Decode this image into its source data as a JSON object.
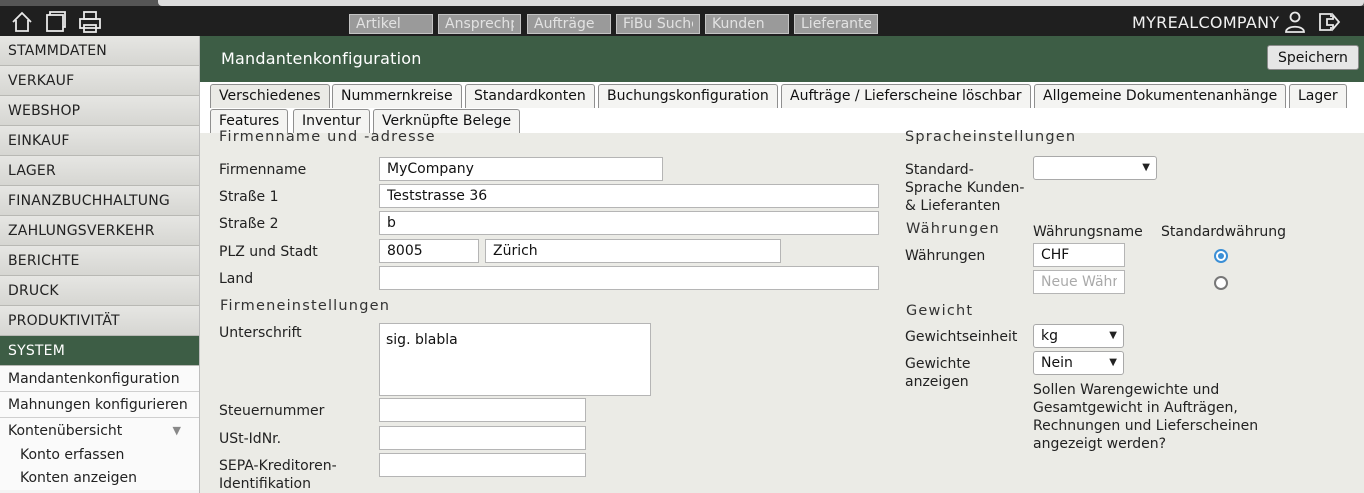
{
  "topbar": {
    "searches": [
      {
        "placeholder": "Artikel"
      },
      {
        "placeholder": "Ansprechpe"
      },
      {
        "placeholder": "Aufträge"
      },
      {
        "placeholder": "FiBu Suche"
      },
      {
        "placeholder": "Kunden"
      },
      {
        "placeholder": "Lieferanten"
      }
    ],
    "company": "MYREALCOMPANY",
    "icons": [
      "home-icon",
      "window-icon",
      "printer-icon",
      "user-icon",
      "logout-icon"
    ]
  },
  "sidebar": {
    "items": [
      {
        "label": "STAMMDATEN"
      },
      {
        "label": "VERKAUF"
      },
      {
        "label": "WEBSHOP"
      },
      {
        "label": "EINKAUF"
      },
      {
        "label": "LAGER"
      },
      {
        "label": "FINANZBUCHHALTUNG"
      },
      {
        "label": "ZAHLUNGSVERKEHR"
      },
      {
        "label": "BERICHTE"
      },
      {
        "label": "DRUCK"
      },
      {
        "label": "PRODUKTIVITÄT"
      },
      {
        "label": "SYSTEM"
      }
    ],
    "subitems": [
      {
        "label": "Mandantenkonfiguration"
      },
      {
        "label": "Mahnungen konfigurieren"
      },
      {
        "label": "Kontenübersicht"
      }
    ],
    "subsubitems": [
      {
        "label": "Konto erfassen"
      },
      {
        "label": "Konten anzeigen"
      }
    ],
    "active_color": "#3d5d45"
  },
  "main": {
    "title": "Mandantenkonfiguration",
    "save_label": "Speichern",
    "tabs": [
      {
        "label": "Verschiedenes"
      },
      {
        "label": "Nummernkreise"
      },
      {
        "label": "Standardkonten"
      },
      {
        "label": "Buchungskonfiguration"
      },
      {
        "label": "Aufträge / Lieferscheine löschbar"
      },
      {
        "label": "Allgemeine Dokumentenanhänge"
      },
      {
        "label": "Lager"
      },
      {
        "label": "Features"
      },
      {
        "label": "Inventur"
      },
      {
        "label": "Verknüpfte Belege"
      }
    ]
  },
  "company_section": {
    "title": "Firmenname und -adresse",
    "name_label": "Firmenname",
    "name_value": "MyCompany",
    "street1_label": "Straße 1",
    "street1_value": "Teststrasse 36",
    "street2_label": "Straße 2",
    "street2_value": "b",
    "zip_city_label": "PLZ und Stadt",
    "zip_value": "8005",
    "city_value": "Zürich",
    "country_label": "Land",
    "country_value": ""
  },
  "settings_section": {
    "title": "Firmeneinstellungen",
    "signature_label": "Unterschrift",
    "signature_value": "sig. blabla",
    "tax_number_label": "Steuernummer",
    "tax_number_value": "",
    "vat_label": "USt-IdNr.",
    "vat_value": "",
    "sepa_label_1": "SEPA-Kreditoren-",
    "sepa_label_2": "Identifikation",
    "sepa_value": ""
  },
  "language_section": {
    "title": "Spracheinstellungen",
    "std_lang_label_1": "Standard-",
    "std_lang_label_2": "Sprache Kunden-",
    "std_lang_label_3": "& Lieferanten",
    "std_lang_value": ""
  },
  "currency_section": {
    "title": "Währungen",
    "col_name": "Währungsname",
    "col_default": "Standardwährung",
    "row_label": "Währungen",
    "currency_value": "CHF",
    "new_placeholder": "Neue Währung"
  },
  "weight_section": {
    "title": "Gewicht",
    "unit_label": "Gewichtseinheit",
    "unit_value": "kg",
    "show_label_1": "Gewichte",
    "show_label_2": "anzeigen",
    "show_value": "Nein",
    "note_1": "Sollen Warengewichte und",
    "note_2": "Gesamtgewicht in Aufträgen,",
    "note_3": "Rechnungen und Lieferscheinen",
    "note_4": "angezeigt werden?"
  }
}
